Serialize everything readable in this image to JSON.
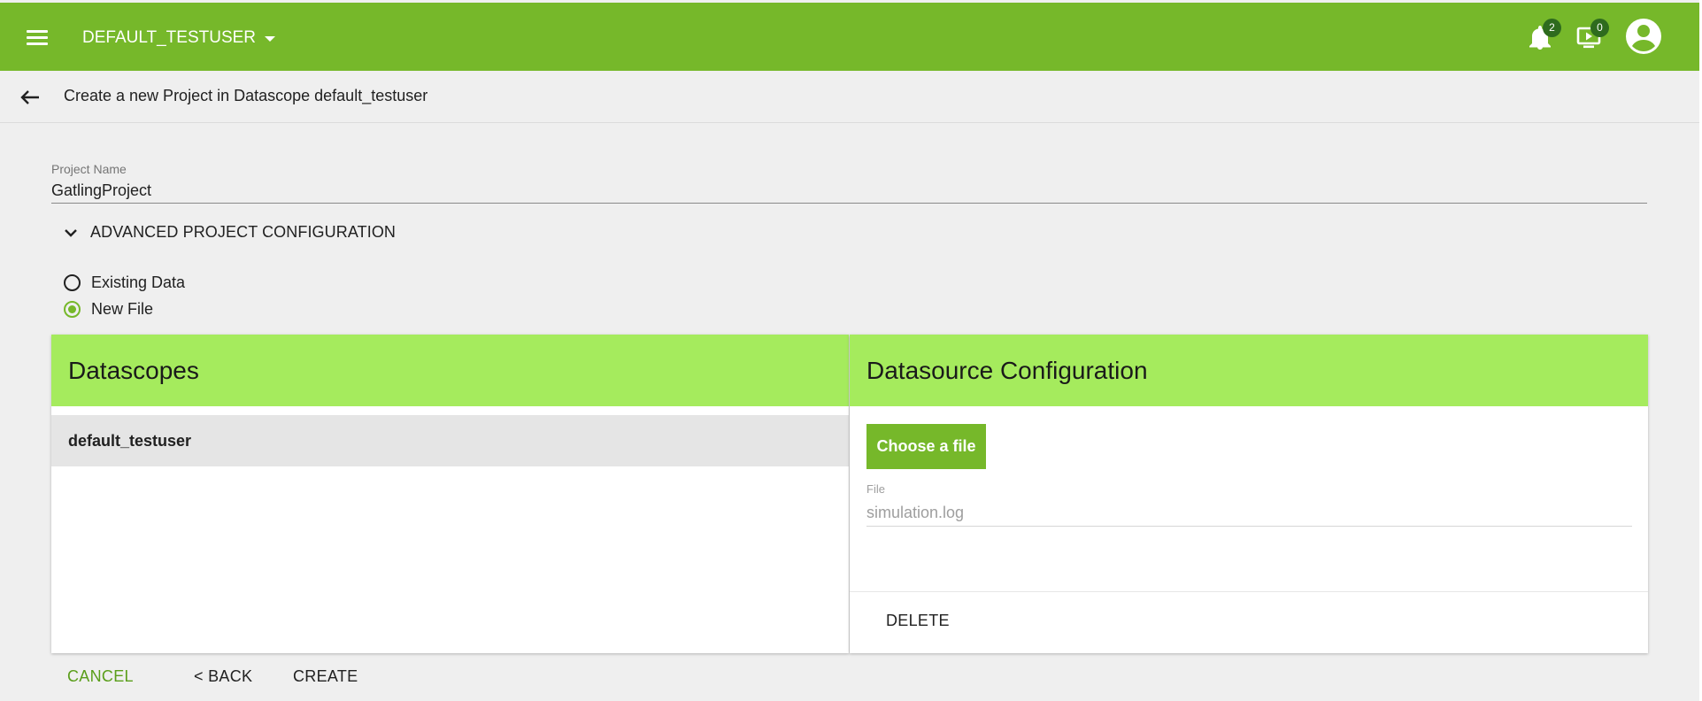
{
  "appbar": {
    "user_label": "DEFAULT_TESTUSER",
    "notifications_count": "2",
    "media_count": "0",
    "colors": {
      "bar": "#76b82a",
      "badge": "#2e6b1e"
    }
  },
  "subheader": {
    "title": "Create a new Project in Datascope default_testuser"
  },
  "form": {
    "project_name_label": "Project Name",
    "project_name_value": "GatlingProject",
    "advanced_label": "ADVANCED PROJECT CONFIGURATION",
    "radio_existing": "Existing Data",
    "radio_new": "New File",
    "selected": "New File"
  },
  "datascopes": {
    "title": "Datascopes",
    "items": [
      "default_testuser"
    ]
  },
  "datasource": {
    "title": "Datasource Configuration",
    "choose_label": "Choose a file",
    "file_label": "File",
    "file_value": "simulation.log",
    "delete_label": "DELETE"
  },
  "actions": {
    "cancel": "CANCEL",
    "back": "< BACK",
    "create": "CREATE"
  },
  "colors": {
    "accent": "#76b82a",
    "panel_header": "#a5eb5d",
    "background": "#efefef"
  }
}
